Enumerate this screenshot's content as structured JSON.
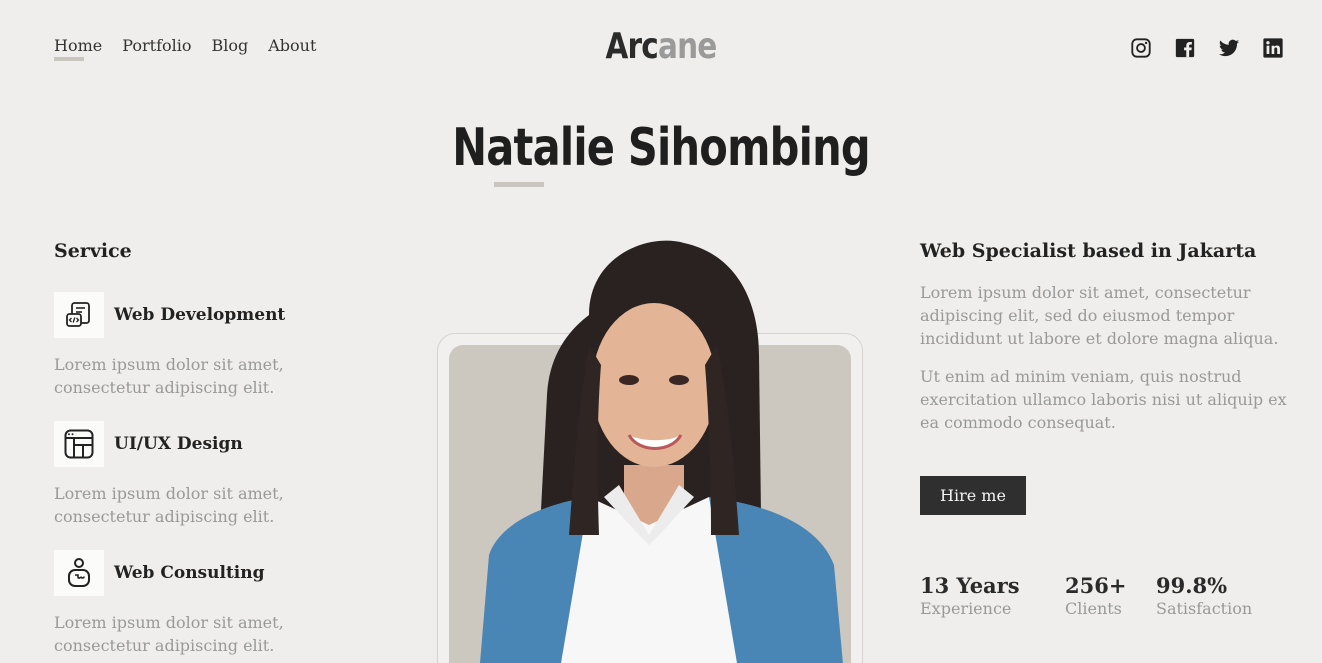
{
  "nav": {
    "items": [
      {
        "label": "Home"
      },
      {
        "label": "Portfolio"
      },
      {
        "label": "Blog"
      },
      {
        "label": "About"
      }
    ]
  },
  "logo": {
    "part1": "Arc",
    "part2": "ane"
  },
  "social": [
    "instagram-icon",
    "facebook-icon",
    "twitter-icon",
    "linkedin-icon"
  ],
  "hero": {
    "name": "Natalie Sihombing"
  },
  "services": {
    "heading": "Service",
    "items": [
      {
        "title": "Web Development",
        "desc": "Lorem ipsum dolor sit amet, consectetur adipiscing elit.",
        "icon": "code-document-icon"
      },
      {
        "title": "UI/UX Design",
        "desc": "Lorem ipsum dolor sit amet, consectetur adipiscing elit.",
        "icon": "layout-grid-icon"
      },
      {
        "title": "Web Consulting",
        "desc": "Lorem ipsum dolor sit amet, consectetur adipiscing elit.",
        "icon": "consultant-icon"
      }
    ]
  },
  "about": {
    "heading": "Web Specialist based in Jakarta",
    "p1": "Lorem ipsum dolor sit amet, consectetur adipiscing elit, sed do eiusmod tempor incididunt ut labore et dolore magna aliqua.",
    "p2": "Ut enim ad minim veniam, quis nostrud exercitation ullamco laboris nisi ut aliquip ex ea commodo consequat.",
    "cta": "Hire me"
  },
  "stats": [
    {
      "value": "13 Years",
      "label": "Experience"
    },
    {
      "value": "256+",
      "label": "Clients"
    },
    {
      "value": "99.8%",
      "label": "Satisfaction"
    }
  ],
  "colors": {
    "background": "#efeeec",
    "accent": "#c9c5bf",
    "button": "#2f2f2f",
    "muted": "#999999"
  }
}
